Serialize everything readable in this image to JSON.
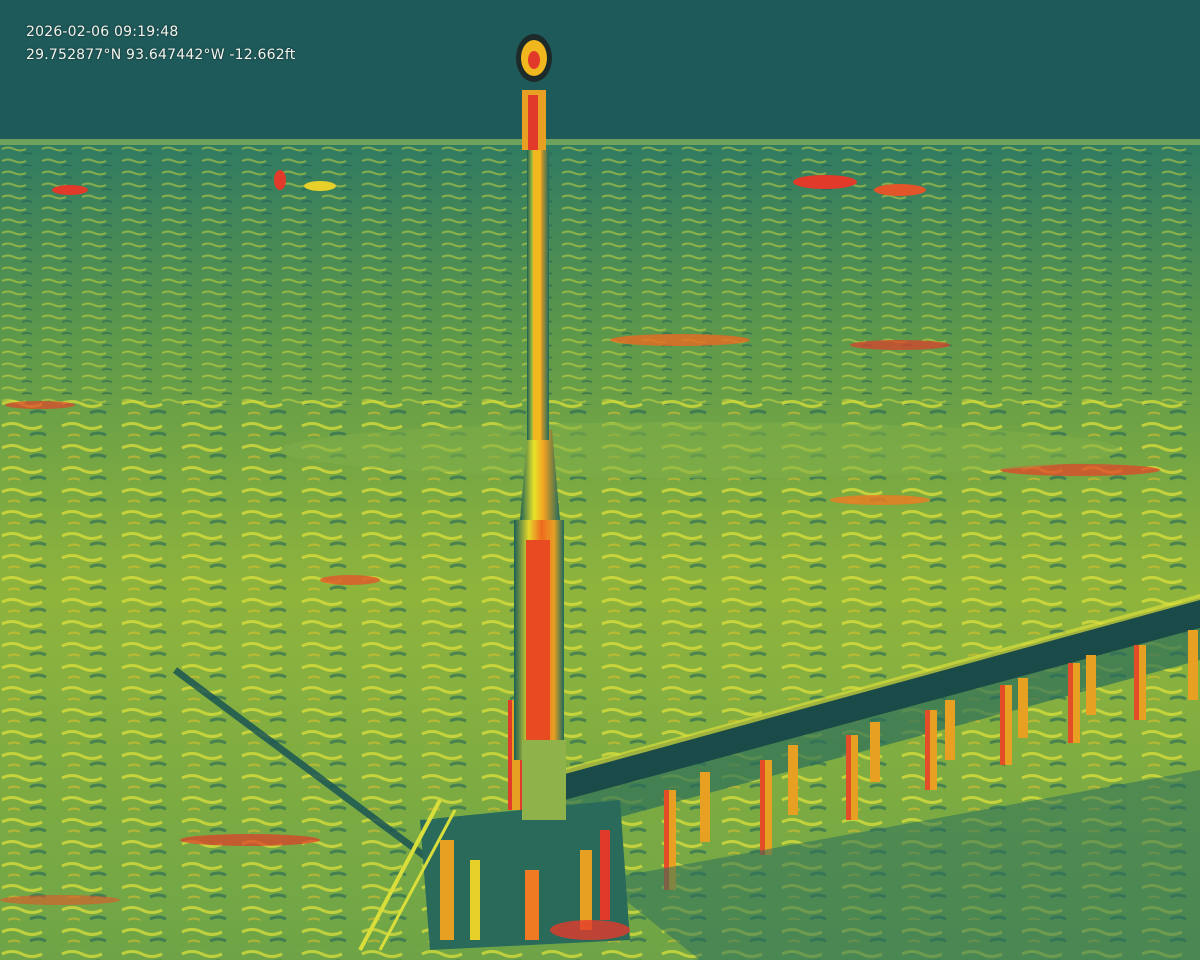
{
  "osd": {
    "timestamp": "2026-02-06 09:19:48",
    "coordinates": "29.752877°N 93.647442°W -12.662ft"
  },
  "palette": {
    "sky": "#1f5a5a",
    "water_base": "#5e9a4a",
    "water_bright": "#d9e23a",
    "hot_yellow": "#f4e81e",
    "hot_orange": "#f08a1e",
    "hot_red": "#e23a2a",
    "cold_teal": "#1c5e5a"
  }
}
